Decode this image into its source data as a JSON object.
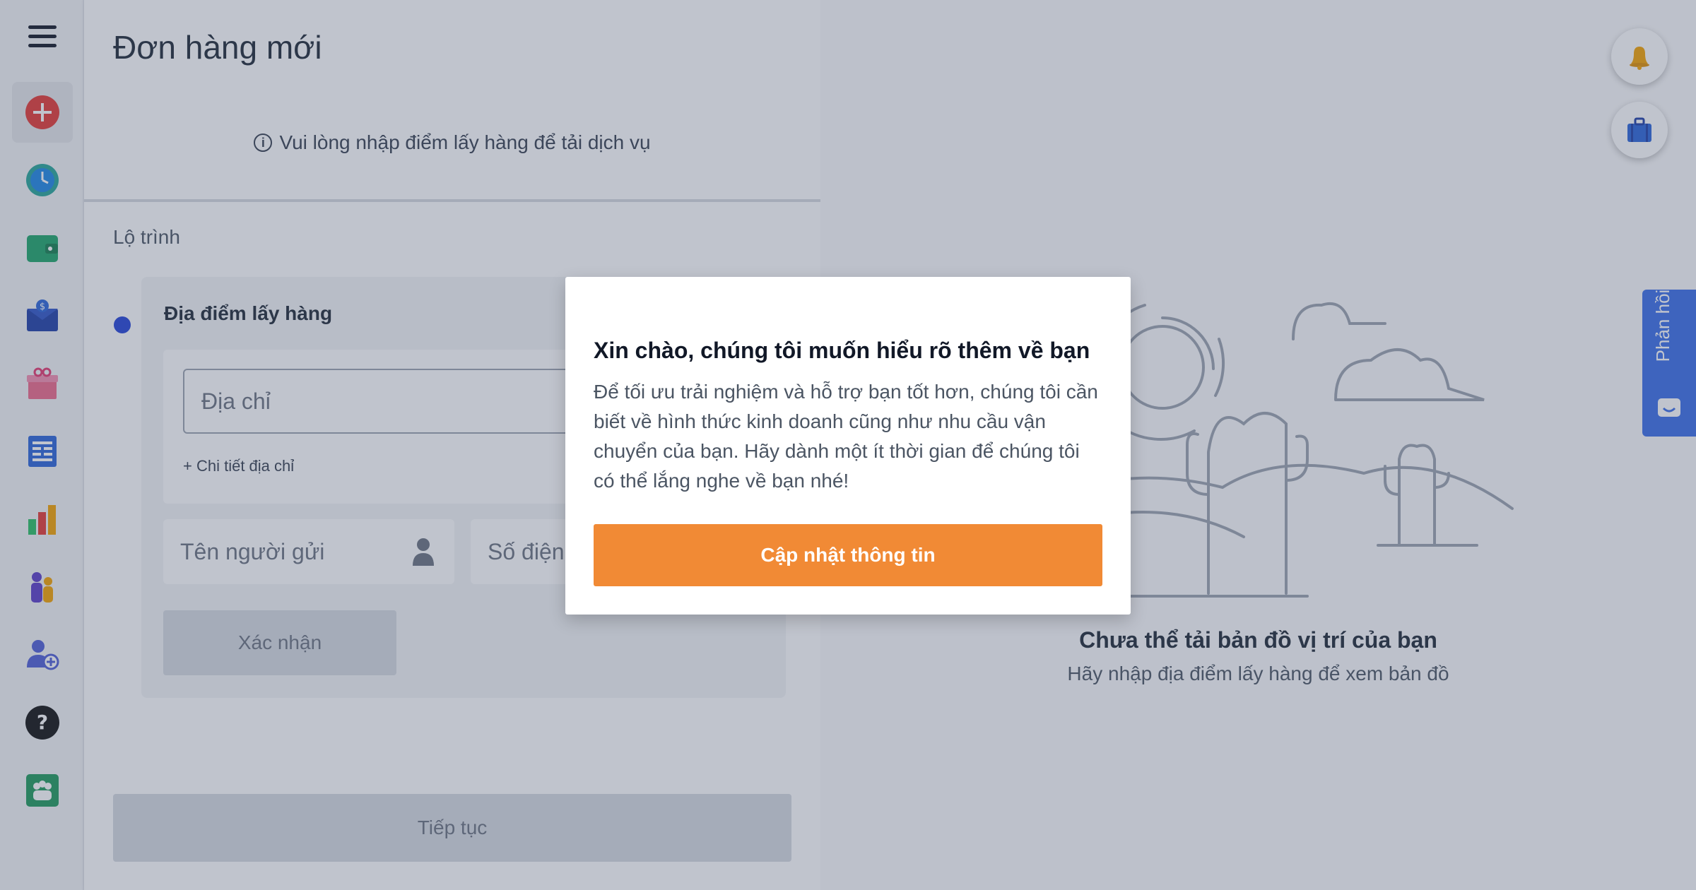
{
  "sidebar": {
    "items": [
      {
        "icon": "plus-circle-icon",
        "color": "#e53935"
      },
      {
        "icon": "clock-icon",
        "color": "#1e88e5"
      },
      {
        "icon": "wallet-icon",
        "color": "#1ea66a"
      },
      {
        "icon": "money-bag-icon",
        "color": "#1f3fa8"
      },
      {
        "icon": "gift-icon",
        "color": "#ef6a8a"
      },
      {
        "icon": "document-icon",
        "color": "#2b65d9"
      },
      {
        "icon": "bar-chart-icon",
        "color": "#2bbf64"
      },
      {
        "icon": "users-icon",
        "color": "#5b3ec9"
      },
      {
        "icon": "add-user-icon",
        "color": "#4f5fd6"
      },
      {
        "icon": "help-icon",
        "color": "#111111"
      },
      {
        "icon": "team-icon",
        "color": "#1f9a5c"
      }
    ]
  },
  "order": {
    "title": "Đơn hàng mới",
    "notice": "Vui lòng nhập điểm lấy hàng để tải dịch vụ",
    "route_label": "Lộ trình",
    "pickup_title": "Địa điểm lấy hàng",
    "address_placeholder": "Địa chỉ",
    "address_detail": "+ Chi tiết địa chỉ",
    "sender_placeholder": "Tên người gửi",
    "phone_placeholder": "Số điện",
    "confirm_label": "Xác nhận",
    "continue_label": "Tiếp tục"
  },
  "map": {
    "title": "Chưa thể tải bản đồ vị trí của bạn",
    "subtitle": "Hãy nhập địa điểm lấy hàng để xem bản đồ"
  },
  "feedback": {
    "label": "Phản hồi"
  },
  "modal": {
    "title": "Xin chào, chúng tôi muốn hiểu rõ thêm về bạn",
    "text": "Để tối ưu trải nghiệm và hỗ trợ bạn tốt hơn, chúng tôi cần biết về hình thức kinh doanh cũng như nhu cầu vận chuyển của bạn. Hãy dành một ít thời gian để chúng tôi có thể lắng nghe về bạn nhé!",
    "button_label": "Cập nhật thông tin"
  },
  "colors": {
    "accent_orange": "#f18a35",
    "primary_blue": "#2443d8",
    "feedback_blue": "#3b6ee8"
  }
}
